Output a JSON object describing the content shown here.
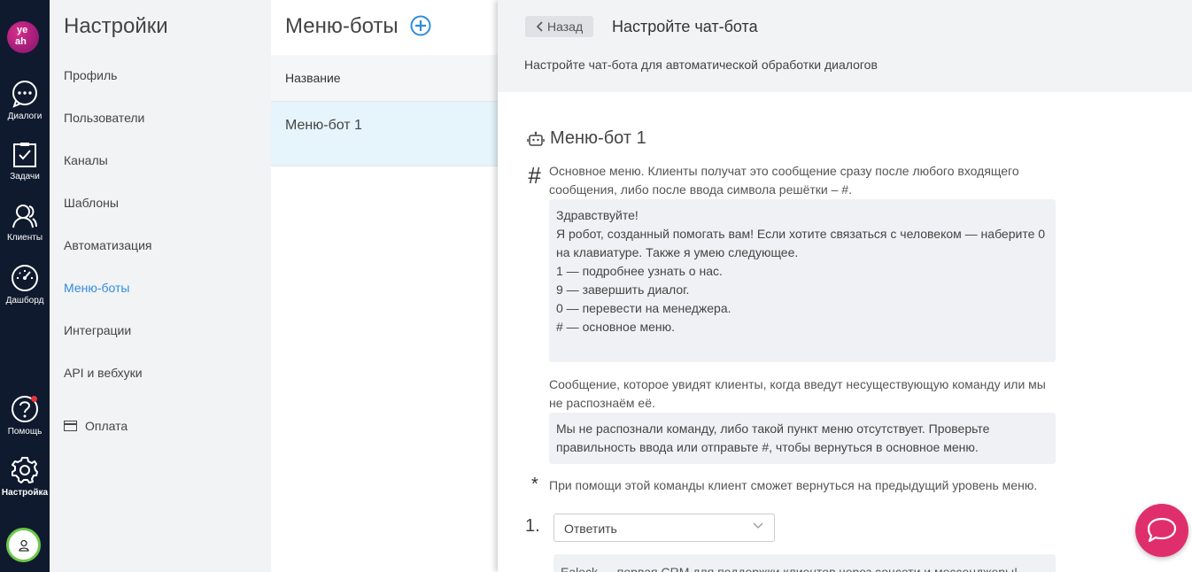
{
  "rail": {
    "logo_text": "ye ah",
    "items": [
      {
        "label": "Диалоги",
        "icon": "chat-bubble-icon"
      },
      {
        "label": "Задачи",
        "icon": "task-clipboard-icon"
      },
      {
        "label": "Клиенты",
        "icon": "users-icon"
      },
      {
        "label": "Дашборд",
        "icon": "speedometer-icon"
      },
      {
        "label": "Помощь",
        "icon": "help-icon"
      },
      {
        "label": "Настройка",
        "icon": "gear-icon"
      }
    ],
    "avatar_icon": "user-icon"
  },
  "settings": {
    "title": "Настройки",
    "items": [
      {
        "label": "Профиль"
      },
      {
        "label": "Пользователи"
      },
      {
        "label": "Каналы"
      },
      {
        "label": "Шаблоны"
      },
      {
        "label": "Автоматизация"
      },
      {
        "label": "Меню-боты",
        "active": true
      },
      {
        "label": "Интеграции"
      },
      {
        "label": "API и вебхуки"
      },
      {
        "label": "Оплата",
        "icon": "card-icon"
      }
    ]
  },
  "bots": {
    "title": "Меню-боты",
    "column_header": "Название",
    "rows": [
      {
        "name": "Меню-бот 1"
      }
    ]
  },
  "panel": {
    "back_label": "Назад",
    "title": "Настройте чат-бота",
    "subtitle": "Настройте чат-бота для автоматической обработки диалогов",
    "bot_name": "Меню-бот 1",
    "main_menu_symbol": "#",
    "main_menu_desc": "Основное меню. Клиенты получат это сообщение сразу после любого входящего сообщения, либо после ввода символа решётки – #.",
    "main_menu_text": "Здравствуйте!\nЯ робот, созданный помогать вам! Если хотите связаться с человеком — наберите 0 на клавиатуре. Также я умею следующее.\n1 — подробнее узнать о нас.\n9 — завершить диалог.\n0  — перевести на менеджера.\n# — основное меню.",
    "unknown_desc": "Сообщение, которое увидят клиенты, когда введут несуществующую команду или мы не распознаём её.",
    "unknown_text": "Мы не распознали команду, либо такой пункт меню отсутствует. Проверьте правильность ввода или отправьте #, чтобы вернуться в основное меню.",
    "back_symbol": "*",
    "back_desc": "При помощи этой команды клиент сможет вернуться на предыдущий уровень меню.",
    "item_number": "1.",
    "item_action": "Ответить",
    "item_text": "Ealeck — первая CRM для поддержки клиентов через соцсети и мессенджеры!"
  },
  "colors": {
    "rail_bg": "#0f1a2e",
    "accent_blue": "#2f8ddd",
    "fab_pink": "#e02e6d",
    "avatar_ring": "#6bc94b"
  }
}
